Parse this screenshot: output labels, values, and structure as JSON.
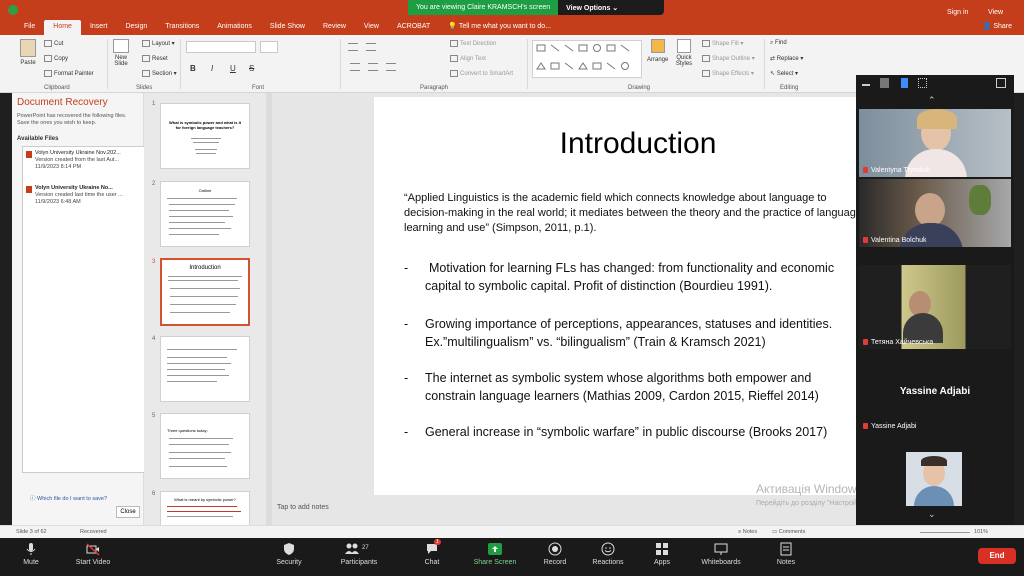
{
  "sharing": {
    "banner": "You are viewing Claire KRAMSCH's screen",
    "view_options": "View Options"
  },
  "ribbon": {
    "tabs": [
      "File",
      "Home",
      "Insert",
      "Design",
      "Transitions",
      "Animations",
      "Slide Show",
      "Review",
      "View",
      "ACROBAT"
    ],
    "tell_me": "Tell me what you want to do...",
    "sign_in": "Sign in",
    "share": "Share",
    "right_view": "View",
    "clipboard": {
      "paste": "Paste",
      "cut": "Cut",
      "copy": "Copy",
      "format_painter": "Format Painter",
      "label": "Clipboard"
    },
    "slides": {
      "new_slide": "New Slide",
      "layout": "Layout",
      "reset": "Reset",
      "section": "Section",
      "label": "Slides"
    },
    "font": {
      "label": "Font",
      "bold": "B",
      "italic": "I",
      "underline": "U",
      "strike": "S"
    },
    "paragraph": {
      "text_direction": "Text Direction",
      "align_text": "Align Text",
      "convert_smartart": "Convert to SmartArt",
      "label": "Paragraph"
    },
    "drawing": {
      "arrange": "Arrange",
      "quick_styles": "Quick Styles",
      "shape_fill": "Shape Fill",
      "shape_outline": "Shape Outline",
      "shape_effects": "Shape Effects",
      "label": "Drawing"
    },
    "editing": {
      "find": "Find",
      "replace": "Replace",
      "select": "Select",
      "label": "Editing"
    }
  },
  "doc_recovery": {
    "title": "Document Recovery",
    "description": "PowerPoint has recovered the following files. Save the ones you wish to keep.",
    "available_files": "Available Files",
    "files": [
      {
        "name": "Volyn University Ukraine Nov.202...",
        "detail": "Version created from the last Aut...",
        "time": "11/9/2023 8:14 PM"
      },
      {
        "name": "Volyn University Ukraine No...",
        "detail": "Version created last time the user ...",
        "time": "11/9/2023 6:48 AM"
      }
    ],
    "which_file": "Which file do I want to save?",
    "close": "Close"
  },
  "thumbnails": [
    {
      "num": "1",
      "title": "What is symbolic power and what is it for foreign language teachers?"
    },
    {
      "num": "2",
      "title": "Outline"
    },
    {
      "num": "3",
      "title": "Introduction"
    },
    {
      "num": "4",
      "title": ""
    },
    {
      "num": "5",
      "title": "Three questions today:"
    },
    {
      "num": "6",
      "title": "What is meant by symbolic power?"
    }
  ],
  "slide": {
    "title": "Introduction",
    "quote": "“Applied Linguistics is the academic field which connects knowledge about language to decision-making in the real world; it mediates between the theory and the practice of language learning and use” (Simpson, 2011, p.1).",
    "bullets": [
      {
        "dash": "-",
        "line1": "Motivation for learning FLs has changed: from functionality and economic",
        "line2": "capital to symbolic capital. Profit of distinction (Bourdieu 1991)."
      },
      {
        "dash": "-",
        "line1": "Growing importance of perceptions, appearances, statuses and identities.",
        "line2": "Ex.”multilingualism” vs. “bilingualism” (Train & Kramsch 2021)"
      },
      {
        "dash": "-",
        "line1": "The internet as symbolic system whose algorithms both empower and",
        "line2": "constrain language learners (Mathias 2009, Cardon 2015, Rieffel 2014)"
      },
      {
        "dash": "-",
        "line1": "General increase in “symbolic warfare” in public discourse (Brooks 2017)",
        "line2": ""
      }
    ]
  },
  "notes_placeholder": "Tap to add notes",
  "status": {
    "slide": "Slide 3 of 62",
    "recovered": "Recovered",
    "notes": "Notes",
    "comments": "Comments",
    "zoom": "101%"
  },
  "windows_watermark": {
    "title": "Активація Windows",
    "line": "Перейдіть до розділу \"Настройки\", щоб активувати Windows."
  },
  "gallery": {
    "participants": [
      {
        "name": "Valentyna Tryndiuk",
        "muted": true
      },
      {
        "name": "Valentina Bolchuk",
        "muted": true
      },
      {
        "name": "Тетяна Хайчевська",
        "muted": true
      },
      {
        "name": "Yassine Adjabi",
        "muted": true
      }
    ],
    "yassine_big": "Yassine Adjabi"
  },
  "zoom_toolbar": {
    "mute": "Mute",
    "start_video": "Start Video",
    "security": "Security",
    "participants": "Participants",
    "participants_count": "27",
    "chat": "Chat",
    "chat_badge": "1",
    "share_screen": "Share Screen",
    "record": "Record",
    "reactions": "Reactions",
    "apps": "Apps",
    "whiteboards": "Whiteboards",
    "notes": "Notes",
    "end": "End"
  },
  "colors": {
    "ppt_accent": "#c43e1c",
    "zoom_green": "#1e9e42",
    "end_red": "#d93025"
  }
}
